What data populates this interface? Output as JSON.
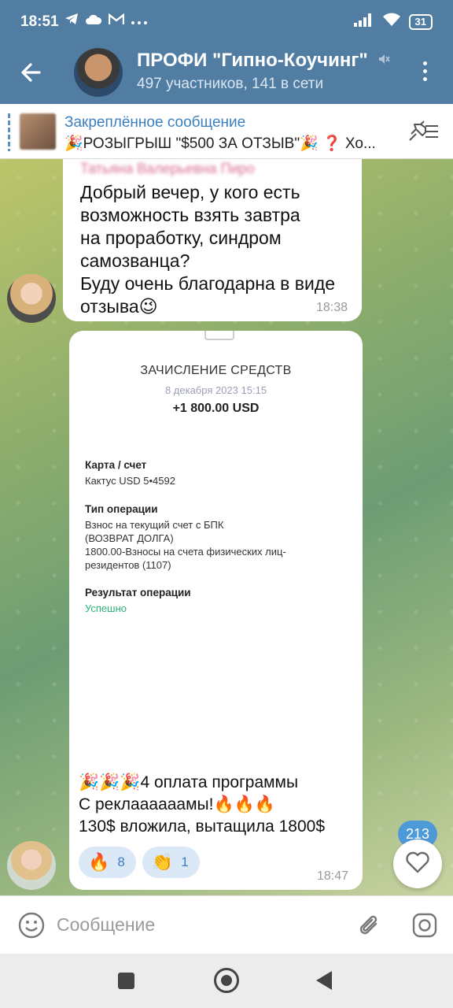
{
  "status_bar": {
    "time": "18:51",
    "battery": "31",
    "icons": [
      "telegram-icon",
      "cloud-icon",
      "gmail-icon",
      "more-dots-icon",
      "signal-icon",
      "wifi-icon",
      "battery-icon"
    ]
  },
  "header": {
    "title": "ПРОФИ \"Гипно-Коучинг\"",
    "subtitle": "497 участников, 141 в сети"
  },
  "pinned": {
    "title": "Закреплённое сообщение",
    "text": "🎉РОЗЫГРЫШ \"$500 ЗА ОТЗЫВ\"🎉 ❓ Хо..."
  },
  "messages": [
    {
      "sender": "Татьяна Валерьевна Пиро",
      "text": "Добрый вечер, у кого есть\nвозможность взять завтра\nна проработку, синдром\nсамозванца?\nБуду очень благодарна в виде\nотзыва😉",
      "time": "18:38"
    },
    {
      "receipt": {
        "title": "ЗАЧИСЛЕНИЕ СРЕДСТВ",
        "date": "8 декабря 2023 15:15",
        "amount": "+1 800.00 USD",
        "card_label": "Карта / счет",
        "card_value": "Кактус USD 5•4592",
        "op_type_label": "Тип операции",
        "op_type_value": "Взнос на текущий счет с БПК\n(ВОЗВРАТ ДОЛГА)\n1800.00-Взносы на счета физических лиц-\nрезидентов (1107)",
        "result_label": "Результат операции",
        "result_value": "Успешно"
      },
      "text": "🎉🎉🎉4 оплата программы\nС реклаааааамы!🔥🔥🔥\n130$ вложила, вытащила 1800$",
      "reactions": [
        {
          "emoji": "🔥",
          "count": "8"
        },
        {
          "emoji": "👏",
          "count": "1"
        }
      ],
      "time": "18:47"
    }
  ],
  "fab": {
    "badge": "213"
  },
  "input": {
    "placeholder": "Сообщение"
  },
  "colors": {
    "header": "#527da3",
    "accent": "#3b80c0",
    "success": "#2bb27a"
  }
}
